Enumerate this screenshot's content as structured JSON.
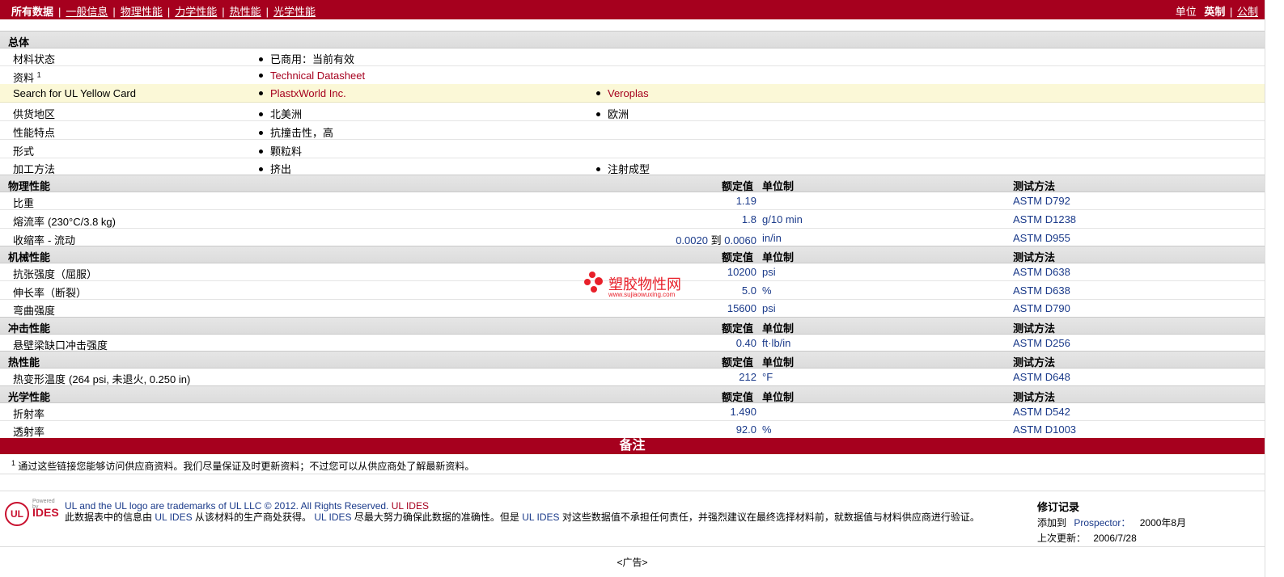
{
  "nav": {
    "items": [
      {
        "label": "所有数据",
        "active": true
      },
      {
        "label": "一般信息"
      },
      {
        "label": "物理性能"
      },
      {
        "label": "力学性能"
      },
      {
        "label": "热性能"
      },
      {
        "label": "光学性能"
      }
    ],
    "units_label": "单位",
    "units_english": "英制",
    "units_metric": "公制"
  },
  "general": {
    "title": "总体",
    "rows": {
      "status": {
        "label": "材料状态",
        "v1": "已商用：当前有效"
      },
      "docs": {
        "label": "资料",
        "sup": "1",
        "v1": "Technical Datasheet"
      },
      "ul": {
        "label": "Search for UL Yellow Card",
        "v1": "PlastxWorld Inc.",
        "v2": "Veroplas"
      },
      "region": {
        "label": "供货地区",
        "v1": "北美洲",
        "v2": "欧洲"
      },
      "features": {
        "label": "性能特点",
        "v1": "抗撞击性，高"
      },
      "form": {
        "label": "形式",
        "v1": "颗粒料"
      },
      "process": {
        "label": "加工方法",
        "v1": "挤出",
        "v2": "注射成型"
      }
    }
  },
  "headers": {
    "nominal": "额定值",
    "unit": "单位制",
    "test": "测试方法"
  },
  "physical": {
    "title": "物理性能",
    "rows": [
      {
        "label": "比重",
        "value": "1.19",
        "unit": "",
        "test": "ASTM D792"
      },
      {
        "label": "熔流率",
        "cond": "(230°C/3.8 kg)",
        "value": "1.8",
        "unit": "g/10 min",
        "test": "ASTM D1238"
      },
      {
        "label": "收缩率",
        "cond": "- 流动",
        "value_from": "0.0020",
        "value_to_word": "到",
        "value_to": "0.0060",
        "unit": "in/in",
        "test": "ASTM D955"
      }
    ]
  },
  "mechanical": {
    "title": "机械性能",
    "rows": [
      {
        "label": "抗张强度（屈服）",
        "value": "10200",
        "unit": "psi",
        "test": "ASTM D638"
      },
      {
        "label": "伸长率（断裂）",
        "value": "5.0",
        "unit": "%",
        "test": "ASTM D638"
      },
      {
        "label": "弯曲强度",
        "value": "15600",
        "unit": "psi",
        "test": "ASTM D790"
      }
    ]
  },
  "impact": {
    "title": "冲击性能",
    "rows": [
      {
        "label": "悬壁梁缺口冲击强度",
        "value": "0.40",
        "unit": "ft·lb/in",
        "test": "ASTM D256"
      }
    ]
  },
  "thermal": {
    "title": "热性能",
    "rows": [
      {
        "label": "热变形温度",
        "cond": "(264 psi, 未退火, 0.250 in)",
        "value": "212",
        "unit": "°F",
        "test": "ASTM D648"
      }
    ]
  },
  "optical": {
    "title": "光学性能",
    "rows": [
      {
        "label": "折射率",
        "value": "1.490",
        "unit": "",
        "test": "ASTM D542"
      },
      {
        "label": "透射率",
        "value": "92.0",
        "unit": "%",
        "test": "ASTM D1003"
      }
    ]
  },
  "notes": {
    "title": "备注",
    "sup": "1",
    "text": "通过这些链接您能够访问供应商资料。我们尽量保证及时更新资料；不过您可以从供应商处了解最新资料。"
  },
  "footer": {
    "logo_powered": "Powered by",
    "logo_ul": "UL",
    "logo_ides": "IDES",
    "trademark": "UL and the UL logo are trademarks of UL LLC © 2012. All Rights Reserved.",
    "trademark_link": "UL IDES",
    "disclaimer_a": "此数据表中的信息由",
    "disclaimer_link1": "UL IDES",
    "disclaimer_b": "从该材料的生产商处获得。",
    "disclaimer_link2": "UL IDES",
    "disclaimer_c": "尽最大努力确保此数据的准确性。但是",
    "disclaimer_link3": "UL IDES",
    "disclaimer_d": "对这些数据值不承担任何责任，并强烈建议在最终选择材料前，就数据值与材料供应商进行验证。"
  },
  "revision": {
    "title": "修订记录",
    "added_label": "添加到",
    "added_target": "Prospector：",
    "added_date": "2000年8月",
    "updated_label": "上次更新：",
    "updated_date": "2006/7/28"
  },
  "ad": "<广告>",
  "watermark": {
    "text": "塑胶物性网",
    "url": "www.sujiaowuxing.com"
  },
  "colors": {
    "brand": "#a6001e",
    "value_blue": "#1a3a8a",
    "yellow_row": "#fbf8d7"
  }
}
